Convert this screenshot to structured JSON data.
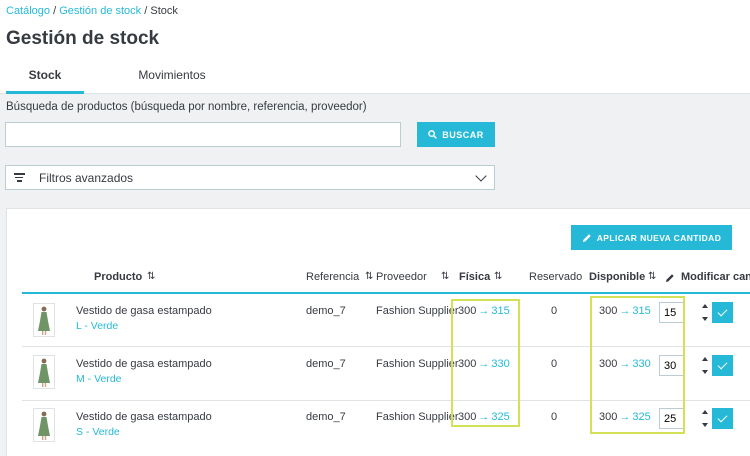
{
  "breadcrumb": {
    "catalog": "Catálogo",
    "sep": "/",
    "stock_mgmt": "Gestión de stock",
    "current": "Stock"
  },
  "page": {
    "title": "Gestión de stock"
  },
  "tabs": [
    {
      "label": "Stock",
      "active": true
    },
    {
      "label": "Movimientos",
      "active": false
    }
  ],
  "search": {
    "label": "Búsqueda de productos (búsqueda por nombre, referencia, proveedor)",
    "value": "",
    "placeholder": "",
    "button_label": "BUSCAR"
  },
  "filters": {
    "label": "Filtros avanzados"
  },
  "apply_button": {
    "label": "APLICAR NUEVA CANTIDAD"
  },
  "table": {
    "headers": {
      "product": "Producto",
      "reference": "Referencia",
      "supplier": "Proveedor",
      "physical": "Física",
      "reserved": "Reservado",
      "available": "Disponible",
      "modify": "Modificar canti"
    },
    "sort_glyph": "⇅",
    "arrow_glyph": "→",
    "rows": [
      {
        "name": "Vestido de gasa estampado",
        "variant": "L - Verde",
        "reference": "demo_7",
        "supplier": "Fashion Supplier",
        "physical_old": "300",
        "physical_new": "315",
        "reserved": "0",
        "available_old": "300",
        "available_new": "315",
        "qty": "15"
      },
      {
        "name": "Vestido de gasa estampado",
        "variant": "M - Verde",
        "reference": "demo_7",
        "supplier": "Fashion Supplier",
        "physical_old": "300",
        "physical_new": "330",
        "reserved": "0",
        "available_old": "300",
        "available_new": "330",
        "qty": "30"
      },
      {
        "name": "Vestido de gasa estampado",
        "variant": "S - Verde",
        "reference": "demo_7",
        "supplier": "Fashion Supplier",
        "physical_old": "300",
        "physical_new": "325",
        "reserved": "0",
        "available_old": "300",
        "available_new": "325",
        "qty": "25"
      }
    ]
  },
  "colors": {
    "accent": "#25b9d7",
    "highlight": "#d4e157",
    "text": "#363a41",
    "background": "#eff1f2"
  },
  "icons": {
    "search": "search-icon",
    "filter": "filter-icon",
    "chevron": "chevron-down-icon",
    "pencil": "pencil-icon",
    "check": "check-icon"
  }
}
